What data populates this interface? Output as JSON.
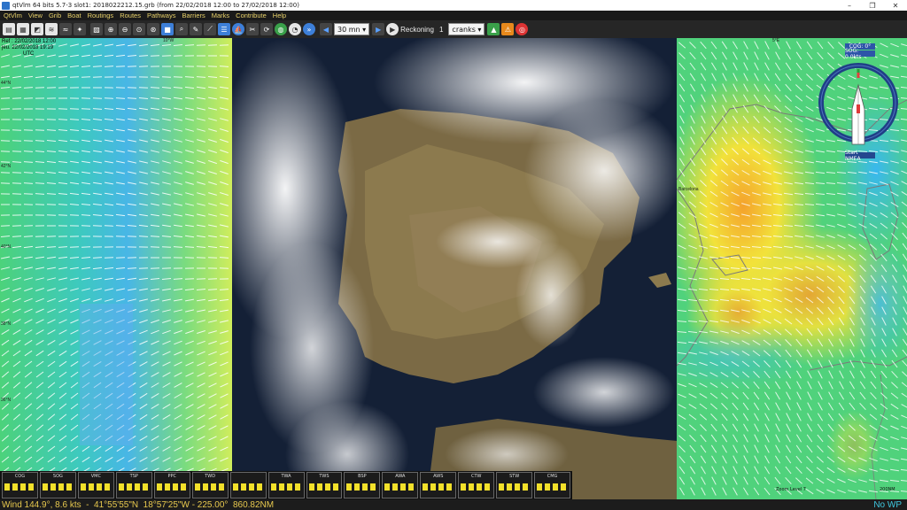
{
  "window": {
    "title": "qtVlm 64 bits 5.7-3 slot1: 2018022212.15.grb (from 22/02/2018 12:00 to 27/02/2018 12:00)",
    "minimize": "–",
    "maximize": "❐",
    "close": "✕"
  },
  "menu": [
    "QtVlm",
    "View",
    "Grib",
    "Boat",
    "Routings",
    "Routes",
    "Pathways",
    "Barriers",
    "Marks",
    "Contribute",
    "Help"
  ],
  "toolbar": {
    "time_step": "30 mn",
    "reckoning_label": "Reckoning",
    "crank_count": "1",
    "cranks_label": "cranks"
  },
  "map": {
    "ref_line": "Ref : 22/02/2018 12:00",
    "date_line": "jeu. 22/02/2018 19:19",
    "utc_label": "UTC",
    "lat_labels": [
      "44°N",
      "42°N",
      "40°N",
      "38°N",
      "36°N"
    ],
    "lon_labels": [
      "10°W",
      "5°E"
    ],
    "places": [
      "Barcelona"
    ],
    "compass": {
      "cog": "COG: 0°",
      "sog": "SOG: 0.0kts",
      "start_nmea": "Start NMEA"
    },
    "zoom_level": "Zoom Level 7",
    "scale": "200NM"
  },
  "instruments": [
    "COG",
    "SOG",
    "VMC",
    "TSP",
    "PPC",
    "TWD",
    "",
    "TWA",
    "TWS",
    "BSP",
    "AWA",
    "AWS",
    "CTW",
    "STW",
    "CMG",
    "DPH",
    "PRE"
  ],
  "status": {
    "wind": "Wind 144.9°, 8.6 kts  -  41°55'55\"N  18°57'25\"W - 225.00°  860.82NM",
    "no_wp": "No WP"
  }
}
